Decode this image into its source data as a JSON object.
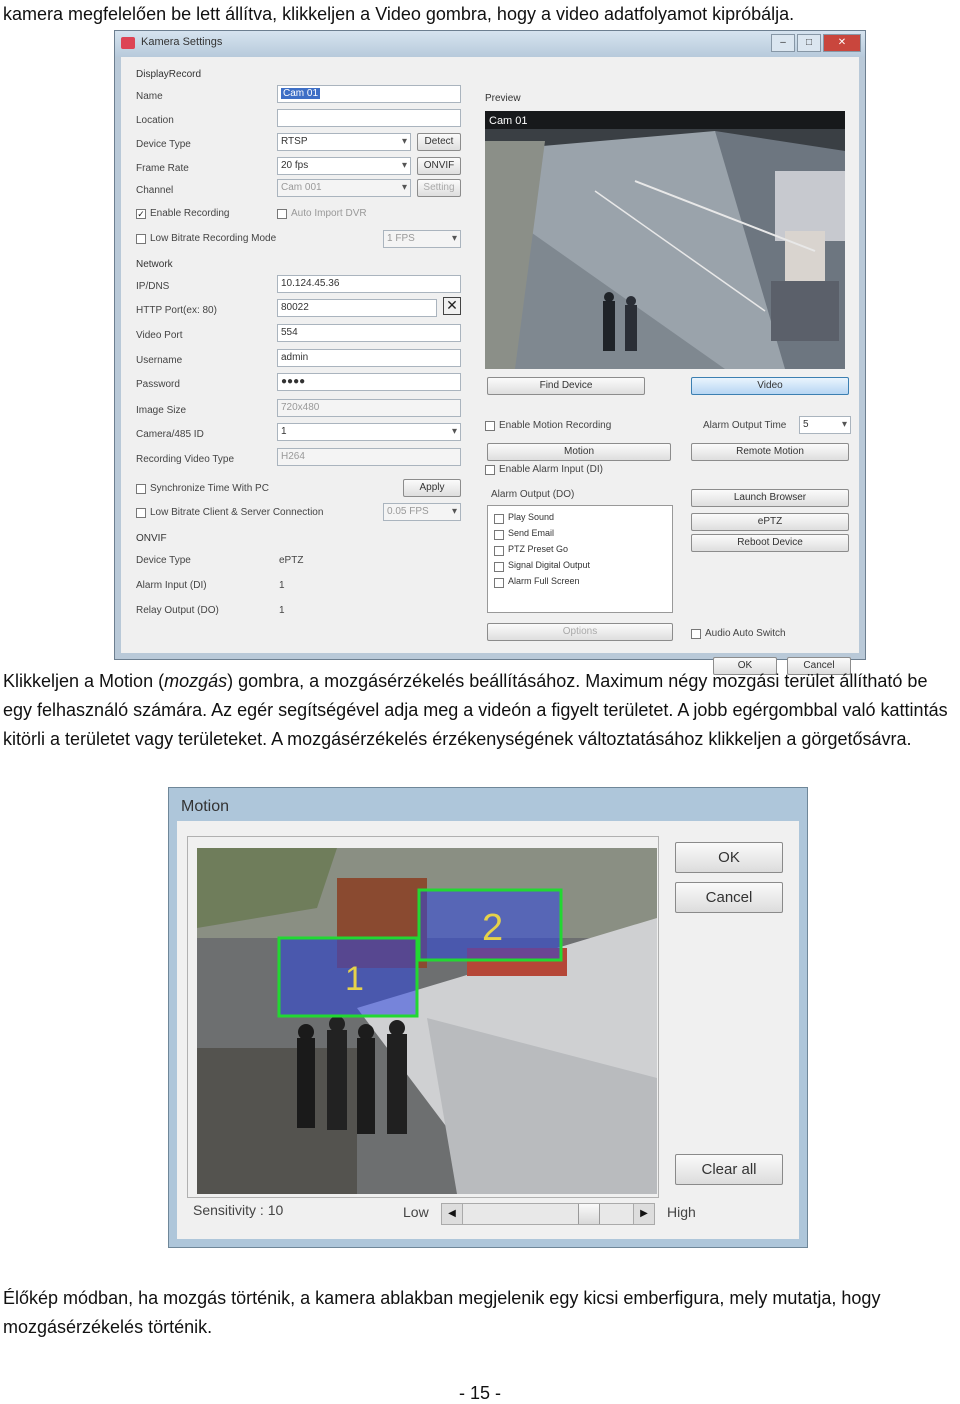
{
  "intro_text": "kamera megfelelően be lett állítva, klikkeljen a Video gombra, hogy a video adatfolyamot kipróbálja.",
  "camera_settings": {
    "window_title": "Kamera Settings",
    "window_buttons": [
      "–",
      "□",
      "✕"
    ],
    "sections": {
      "display": "DisplayRecord",
      "network": "Network",
      "onvif": "ONVIF",
      "preview": "Preview"
    },
    "fields": {
      "name_label": "Name",
      "name_value": "Cam 01",
      "location_label": "Location",
      "location_value": "",
      "device_type_label": "Device Type",
      "device_type_value": "RTSP",
      "frame_rate_label": "Frame Rate",
      "frame_rate_value": "20 fps",
      "channel_label": "Channel",
      "channel_value": "Cam 001",
      "ip_label": "IP/DNS",
      "ip_value": "10.124.45.36",
      "http_label": "HTTP Port(ex: 80)",
      "http_value": "80022",
      "video_port_label": "Video Port",
      "video_port_value": "554",
      "username_label": "Username",
      "username_value": "admin",
      "password_label": "Password",
      "password_value": "●●●●",
      "image_size_label": "Image Size",
      "image_size_value": "720x480",
      "camera_id_label": "Camera/485 ID",
      "camera_id_value": "1",
      "video_type_label": "Recording Video Type",
      "video_type_value": "H264",
      "onvif_device_type_label": "Device Type",
      "onvif_device_type_value": "ePTZ",
      "alarm_input_label": "Alarm Input (DI)",
      "alarm_input_value": "1",
      "relay_output_label": "Relay Output (DO)",
      "relay_output_value": "1"
    },
    "checkboxes": {
      "enable_recording": "Enable Recording",
      "auto_import": "Auto Import DVR",
      "low_bitrate_mode": "Low Bitrate Recording Mode",
      "low_bitrate_fps": "1 FPS",
      "sync_time": "Synchronize Time With PC",
      "low_bitrate_client": "Low Bitrate Client & Server Connection",
      "low_bitrate_client_fps": "0.05 FPS",
      "enable_motion": "Enable Motion Recording",
      "enable_alarm": "Enable Alarm Input (DI)",
      "audio_auto_switch": "Audio Auto Switch"
    },
    "buttons": {
      "detect": "Detect",
      "onvif": "ONVIF",
      "setting": "Setting",
      "apply": "Apply",
      "find_device": "Find Device",
      "video": "Video",
      "motion": "Motion",
      "alarm_output_time_label": "Alarm Output Time",
      "alarm_output_time_value": "5",
      "remote_motion": "Remote Motion",
      "launch_browser": "Launch Browser",
      "eptz": "ePTZ",
      "reboot": "Reboot Device",
      "options": "Options",
      "ok": "OK",
      "cancel": "Cancel"
    },
    "preview_label": "Cam 01",
    "alarm_output_label": "Alarm Output (DO)",
    "alarm_items": [
      "Play Sound",
      "Send Email",
      "PTZ Preset Go",
      "Signal Digital Output",
      "Alarm Full Screen"
    ]
  },
  "motion_paragraph_1_a": "Klikkeljen a Motion (",
  "motion_paragraph_1_italic": "mozgás",
  "motion_paragraph_1_b": ") gombra, a mozgásérzékelés beállításához. Maximum négy mozgási terület állítható be egy felhasználó számára. Az egér segítségével adja meg a videón a figyelt területet. A jobb egérgombbal való kattintás kitörli a területet vagy területeket. A mozgásérzékelés érzékenységének változtatásához klikkeljen a görgetősávra.",
  "motion_dialog": {
    "title": "Motion",
    "ok": "OK",
    "cancel": "Cancel",
    "clear_all": "Clear all",
    "sensitivity_label": "Sensitivity : 10",
    "low": "Low",
    "high": "High",
    "zone_labels": [
      "1",
      "2"
    ]
  },
  "closing_text": "Élőkép módban, ha mozgás történik, a kamera ablakban megjelenik egy kicsi emberfigura, mely mutatja, hogy mozgásérzékelés történik.",
  "page_number": "- 15 -"
}
